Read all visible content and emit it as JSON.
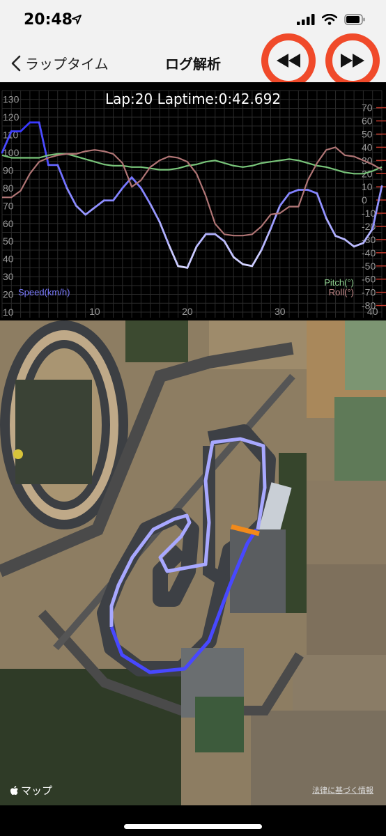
{
  "status": {
    "time": "20:48"
  },
  "nav": {
    "back_label": "ラップタイム",
    "title": "ログ解析"
  },
  "chart_data": {
    "type": "line",
    "title": "Lap:20  Laptime:0:42.692",
    "x": [
      0,
      1,
      2,
      3,
      4,
      5,
      6,
      7,
      8,
      9,
      10,
      11,
      12,
      13,
      14,
      15,
      16,
      17,
      18,
      19,
      20,
      21,
      22,
      23,
      24,
      25,
      26,
      27,
      28,
      29,
      30,
      31,
      32,
      33,
      34,
      35,
      36,
      37,
      38,
      39,
      40,
      41
    ],
    "xticks": [
      10,
      20,
      30,
      40
    ],
    "xlim": [
      0,
      41
    ],
    "left_axis": {
      "ylim": [
        10,
        135
      ],
      "ticks": [
        10,
        20,
        30,
        40,
        50,
        60,
        70,
        80,
        90,
        100,
        110,
        120,
        130
      ]
    },
    "right_axis": {
      "ylim": [
        -85,
        83
      ],
      "ticks": [
        70,
        60,
        50,
        40,
        30,
        20,
        10,
        0,
        -10,
        -20,
        -30,
        -40,
        -50,
        -60,
        -70,
        -80
      ]
    },
    "series": [
      {
        "name": "Speed(km/h)",
        "axis": "left",
        "color": "#6b6bff",
        "values": [
          100,
          112,
          112,
          117,
          117,
          93,
          93,
          80,
          70,
          65,
          69,
          73,
          73,
          80,
          86,
          80,
          71,
          61,
          48,
          36,
          35,
          47,
          54,
          54,
          50,
          41,
          37,
          36,
          45,
          57,
          70,
          77,
          79,
          79,
          77,
          63,
          53,
          51,
          47,
          49,
          57,
          81
        ]
      },
      {
        "name": "Pitch(°)",
        "axis": "right",
        "color": "#79c57a",
        "values": [
          34,
          32,
          32,
          32,
          32,
          34,
          35,
          35,
          33,
          31,
          29,
          27,
          26,
          26,
          25,
          25,
          24,
          23,
          23,
          24,
          26,
          27,
          29,
          30,
          28,
          26,
          25,
          26,
          28,
          29,
          30,
          31,
          30,
          28,
          26,
          25,
          23,
          21,
          20,
          20,
          22,
          25
        ]
      },
      {
        "name": "Roll(°)",
        "axis": "right",
        "color": "#b07575",
        "values": [
          2,
          2,
          7,
          20,
          29,
          32,
          34,
          35,
          35,
          37,
          38,
          37,
          35,
          28,
          10,
          15,
          25,
          30,
          33,
          32,
          29,
          20,
          3,
          -18,
          -26,
          -27,
          -27,
          -26,
          -20,
          -11,
          -10,
          -5,
          -5,
          15,
          28,
          38,
          40,
          34,
          33,
          30,
          27,
          23
        ]
      }
    ],
    "legend": [
      "Speed(km/h)",
      "Pitch(°)",
      "Roll(°)"
    ],
    "grid": true
  },
  "map": {
    "logo_text": "マップ",
    "legal_text": "法律に基づく情報"
  }
}
